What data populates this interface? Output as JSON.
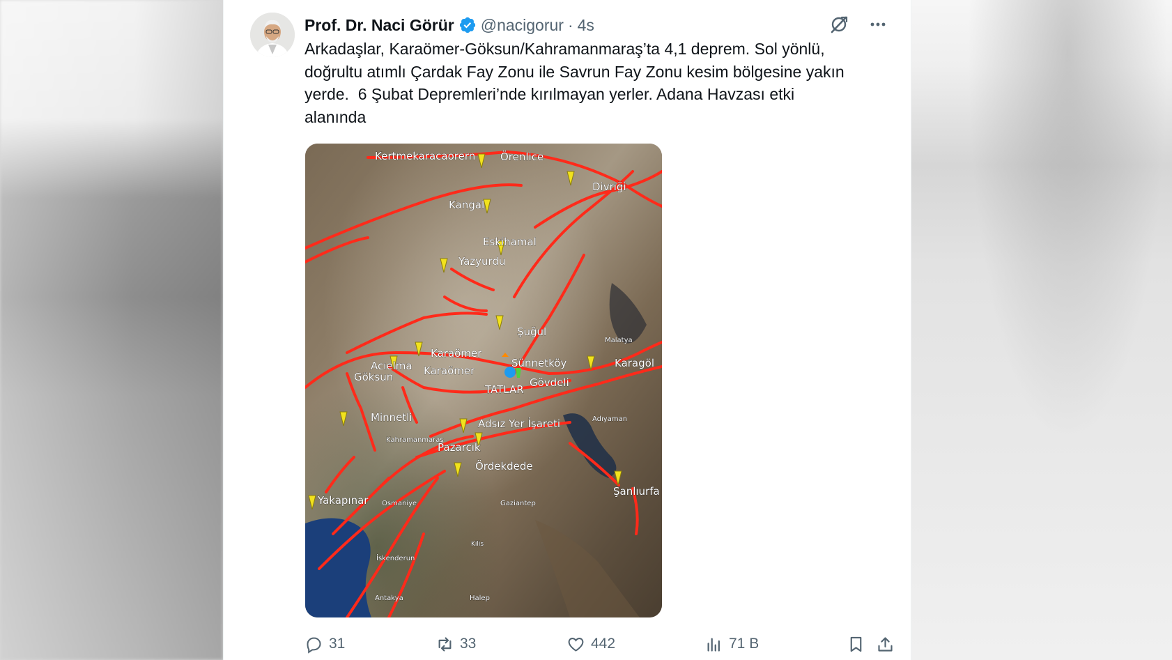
{
  "post": {
    "author": {
      "display_name": "Prof. Dr. Naci Görür",
      "handle": "@nacigorur",
      "separator": "·",
      "time": "4s",
      "verified": true
    },
    "text": "Arkadaşlar, Karaömer-Göksun/Kahramanmaraş’ta 4,1 deprem. Sol yönlü,\ndoğrultu atımlı Çardak Fay Zonu ile Savrun Fay Zonu kesim bölgesine yakın\nyerde.  6 Şubat Depremleri’nde kırılmayan yerler. Adana Havzası etki\nalanında",
    "map_labels": [
      "Kertmekaracaorern",
      "Örenlice",
      "Divriği",
      "Kangal",
      "Eskihamal",
      "Yazyurdu",
      "Şuğul",
      "Malatya",
      "Karaömer",
      "Sünnetköy",
      "Karagöl",
      "Acıelma",
      "Göksun",
      "Karaömer",
      "Gövdeli",
      "TATLAR",
      "Minnetli",
      "Adıyaman",
      "Adsız Yer İşareti",
      "Kahramanmaraş",
      "Pazarcık",
      "Ördekdede",
      "Şanlıurfa",
      "Yakapınar",
      "Osmaniye",
      "Gaziantep",
      "Kilis",
      "İskenderun",
      "Antakya",
      "Halep"
    ],
    "actions": {
      "replies": "31",
      "reposts": "33",
      "likes": "442",
      "views": "71 B"
    }
  },
  "icons": {
    "verified": "verified-badge-icon",
    "grok": "grok-icon",
    "more": "more-icon",
    "reply": "reply-icon",
    "repost": "repost-icon",
    "like": "like-icon",
    "views": "views-icon",
    "bookmark": "bookmark-icon",
    "share": "share-icon"
  },
  "colors": {
    "accent": "#1d9bf0",
    "text": "#0f1419",
    "muted": "#536471",
    "fault_lines": "#ff2a1a",
    "pins": "#f2e21d"
  }
}
